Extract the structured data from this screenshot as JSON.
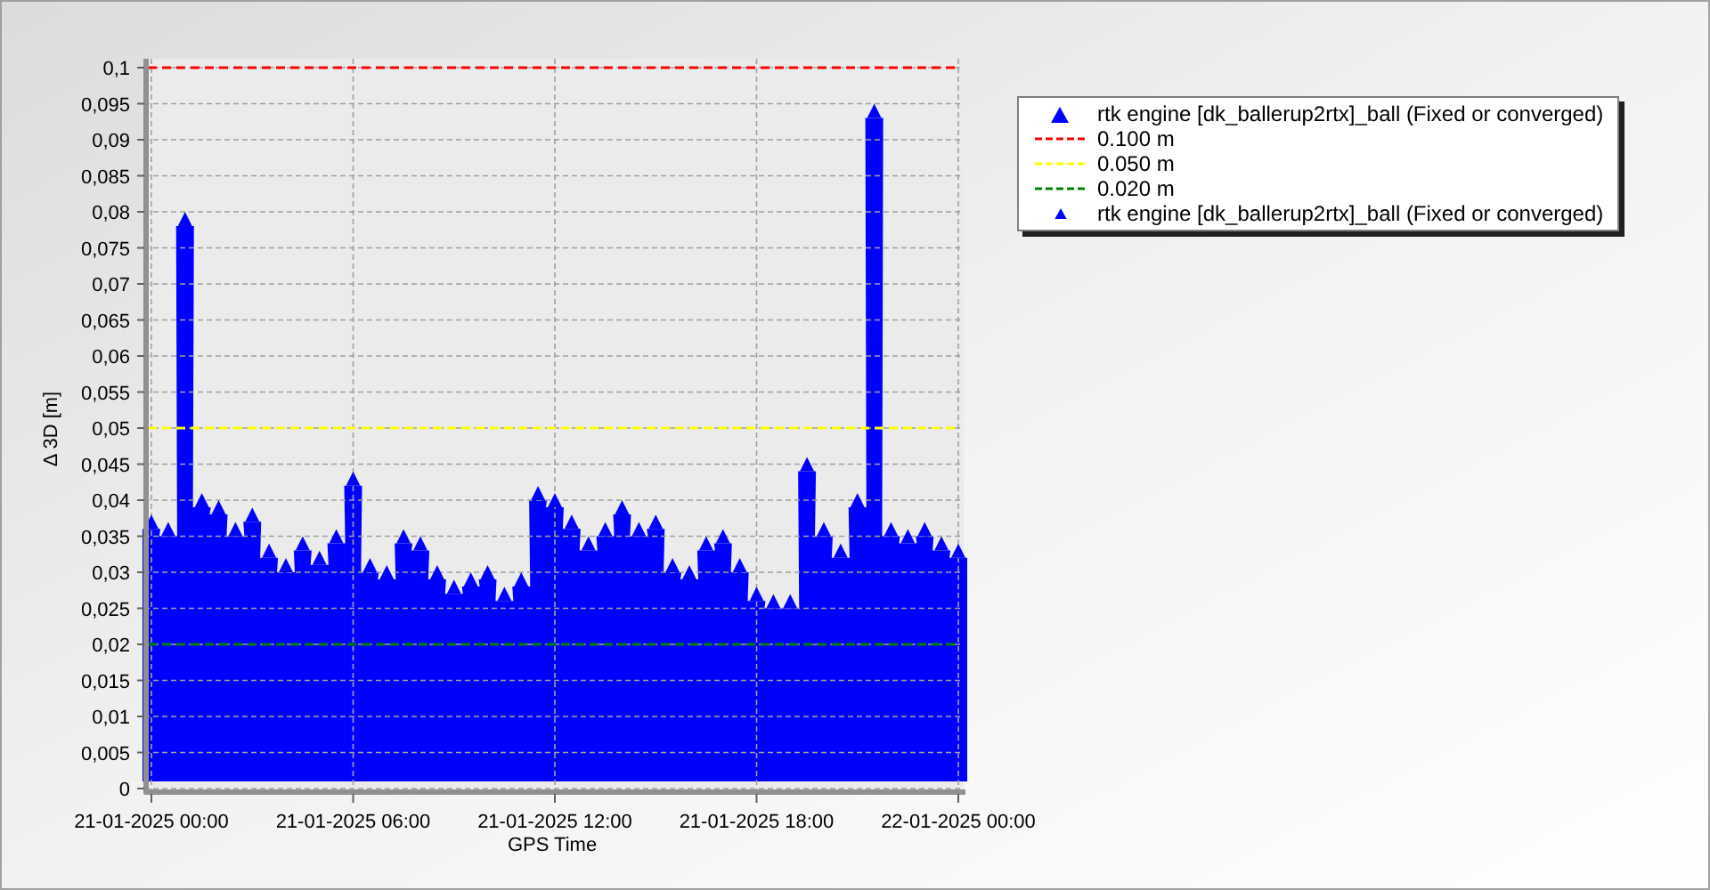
{
  "chart": {
    "chart_data": {
      "type": "scatter",
      "xlabel": "GPS Time",
      "ylabel": "Δ 3D [m]",
      "categories": [
        "21-01-2025 00:00",
        null,
        null,
        null,
        null,
        null,
        null,
        null,
        null,
        null,
        null,
        null,
        "21-01-2025 06:00",
        null,
        null,
        null,
        null,
        null,
        null,
        null,
        null,
        null,
        null,
        null,
        "21-01-2025 12:00",
        null,
        null,
        null,
        null,
        null,
        null,
        null,
        null,
        null,
        null,
        null,
        "21-01-2025 18:00",
        null,
        null,
        null,
        null,
        null,
        null,
        null,
        null,
        null,
        null,
        null,
        "22-01-2025 00:00"
      ],
      "series": [
        {
          "name": "rtk engine [dk_ballerup2rtx]_ball (Fixed or converged)",
          "color": "#0000ff",
          "values": [
            0.037,
            0.036,
            0.079,
            0.04,
            0.039,
            0.036,
            0.038,
            0.033,
            0.031,
            0.034,
            0.032,
            0.035,
            0.043,
            0.031,
            0.03,
            0.035,
            0.034,
            0.03,
            0.028,
            0.029,
            0.03,
            0.027,
            0.029,
            0.041,
            0.04,
            0.037,
            0.034,
            0.036,
            0.039,
            0.036,
            0.037,
            0.031,
            0.03,
            0.034,
            0.035,
            0.031,
            0.027,
            0.026,
            0.026,
            0.045,
            0.036,
            0.033,
            0.04,
            0.094,
            0.036,
            0.035,
            0.036,
            0.034,
            0.033
          ]
        }
      ],
      "ylim": [
        0,
        0.1
      ],
      "yticks": [
        {
          "value": 0,
          "label": "0"
        },
        {
          "value": 0.005,
          "label": "0,005"
        },
        {
          "value": 0.01,
          "label": "0,01"
        },
        {
          "value": 0.015,
          "label": "0,015"
        },
        {
          "value": 0.02,
          "label": "0,02"
        },
        {
          "value": 0.025,
          "label": "0,025"
        },
        {
          "value": 0.03,
          "label": "0,03"
        },
        {
          "value": 0.035,
          "label": "0,035"
        },
        {
          "value": 0.04,
          "label": "0,04"
        },
        {
          "value": 0.045,
          "label": "0,045"
        },
        {
          "value": 0.05,
          "label": "0,05"
        },
        {
          "value": 0.055,
          "label": "0,055"
        },
        {
          "value": 0.06,
          "label": "0,06"
        },
        {
          "value": 0.065,
          "label": "0,065"
        },
        {
          "value": 0.07,
          "label": "0,07"
        },
        {
          "value": 0.075,
          "label": "0,075"
        },
        {
          "value": 0.08,
          "label": "0,08"
        },
        {
          "value": 0.085,
          "label": "0,085"
        },
        {
          "value": 0.09,
          "label": "0,09"
        },
        {
          "value": 0.095,
          "label": "0,095"
        },
        {
          "value": 0.1,
          "label": "0,1"
        }
      ],
      "grid": true,
      "ref_lines": [
        {
          "axis": "y",
          "value": 0.1,
          "color": "#ff0000"
        },
        {
          "axis": "y",
          "value": 0.05,
          "color": "#ffff00"
        },
        {
          "axis": "y",
          "value": 0.02,
          "color": "#008000"
        }
      ]
    }
  },
  "legend": {
    "items": [
      {
        "kind": "series-marker"
      },
      {
        "kind": "line",
        "label": "0.100 m",
        "color": "#ff0000"
      },
      {
        "kind": "line",
        "label": "0.050 m",
        "color": "#ffff00"
      },
      {
        "kind": "line",
        "label": "0.020 m",
        "color": "#008000"
      },
      {
        "kind": "marker-small",
        "label": "rtk engine [dk_ballerup2rtx]_ball (Fixed or converged)",
        "color": "#0000ff"
      }
    ]
  }
}
